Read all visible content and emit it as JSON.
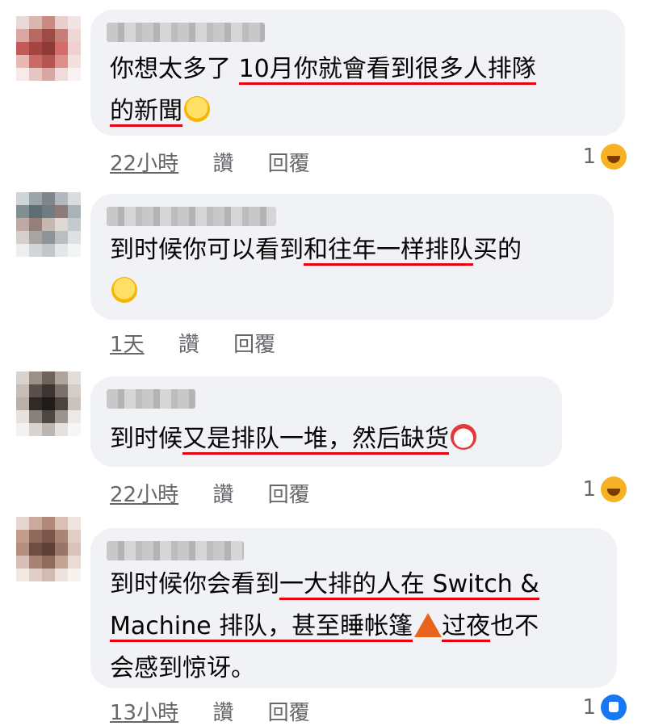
{
  "comments": [
    {
      "lines": [
        [
          {
            "t": "你想太多了 "
          },
          {
            "t": "10月你就會看到很多人排隊",
            "hl": true
          }
        ],
        [
          {
            "t": "的新聞",
            "hl": true
          },
          {
            "emoji": "rofl"
          }
        ]
      ],
      "time": "22小時",
      "like": "讚",
      "reply": "回覆",
      "reaction_count": "1",
      "reaction": "haha"
    },
    {
      "lines": [
        [
          {
            "t": "到时候你可以看到"
          },
          {
            "t": "和往年一样排队",
            "hl": true
          },
          {
            "t": "买的"
          }
        ],
        [
          {
            "emoji": "joy"
          }
        ]
      ],
      "time": "1天",
      "like": "讚",
      "reply": "回覆",
      "reaction_count": "",
      "reaction": ""
    },
    {
      "lines": [
        [
          {
            "t": "到时候"
          },
          {
            "t": "又是排队一堆，然后缺货",
            "hl": true
          },
          {
            "emoji": "clown"
          }
        ]
      ],
      "time": "22小時",
      "like": "讚",
      "reply": "回覆",
      "reaction_count": "1",
      "reaction": "haha"
    },
    {
      "lines": [
        [
          {
            "t": "到时候你会看到"
          },
          {
            "t": "一大排的人在 Switch &",
            "hl": true
          }
        ],
        [
          {
            "t": "Machine 排队，甚至睡帐篷",
            "hl": true
          },
          {
            "emoji": "tent"
          },
          {
            "t": "过夜",
            "hl": true
          },
          {
            "t": "也不"
          }
        ],
        [
          {
            "t": "会感到惊讶。"
          }
        ]
      ],
      "time": "13小時",
      "like": "讚",
      "reply": "回覆",
      "reaction_count": "1",
      "reaction": "like"
    }
  ],
  "colors": {
    "bubble": "#f0f2f5",
    "underline": "#e60012",
    "meta": "#65676b",
    "like_blue": "#1877f2",
    "haha_yellow": "#f7b125"
  }
}
